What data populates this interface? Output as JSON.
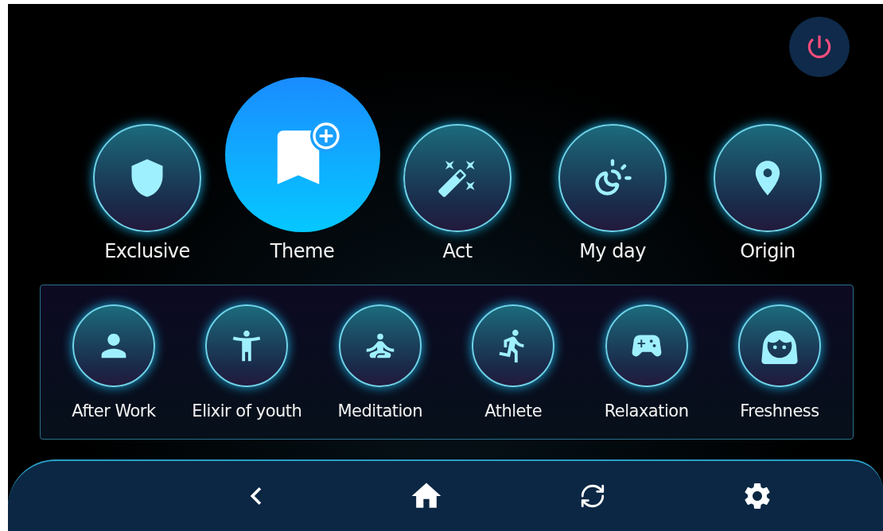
{
  "modes": [
    {
      "label": "Exclusive",
      "selected": false
    },
    {
      "label": "Theme",
      "selected": true
    },
    {
      "label": "Act",
      "selected": false
    },
    {
      "label": "My day",
      "selected": false
    },
    {
      "label": "Origin",
      "selected": false
    }
  ],
  "scenes": [
    {
      "label": "After Work"
    },
    {
      "label": "Elixir of youth"
    },
    {
      "label": "Meditation"
    },
    {
      "label": "Athlete"
    },
    {
      "label": "Relaxation"
    },
    {
      "label": "Freshness"
    }
  ]
}
